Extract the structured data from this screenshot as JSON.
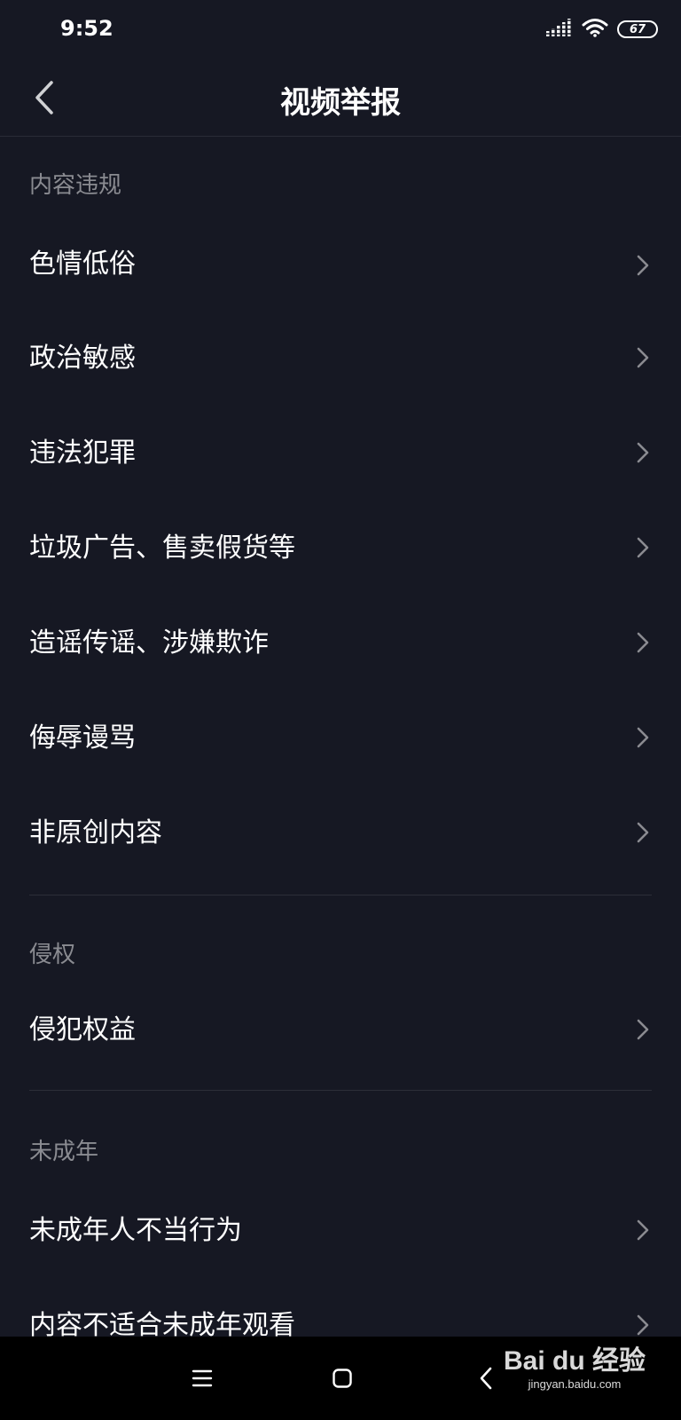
{
  "status_bar": {
    "time": "9:52",
    "battery": "67",
    "icons": [
      "signal-icon",
      "wifi-icon",
      "battery-icon"
    ]
  },
  "header": {
    "title": "视频举报",
    "back_icon": "chevron-left-icon"
  },
  "sections": [
    {
      "title": "内容违规",
      "items": [
        {
          "label": "色情低俗"
        },
        {
          "label": "政治敏感"
        },
        {
          "label": "违法犯罪"
        },
        {
          "label": "垃圾广告、售卖假货等"
        },
        {
          "label": "造谣传谣、涉嫌欺诈"
        },
        {
          "label": "侮辱谩骂"
        },
        {
          "label": "非原创内容"
        }
      ]
    },
    {
      "title": "侵权",
      "items": [
        {
          "label": "侵犯权益"
        }
      ]
    },
    {
      "title": "未成年",
      "items": [
        {
          "label": "未成年人不当行为"
        },
        {
          "label": "内容不适合未成年观看"
        }
      ]
    }
  ],
  "nav_bar": {
    "icons": [
      "menu-icon",
      "home-square-icon",
      "back-icon"
    ]
  },
  "watermark": {
    "brand": "Bai du 经验",
    "url": "jingyan.baidu.com"
  },
  "colors": {
    "background": "#161823",
    "text": "#ffffff",
    "section_title": "#8a8b91",
    "divider": "#2c2e38",
    "nav_bar": "#000000"
  }
}
